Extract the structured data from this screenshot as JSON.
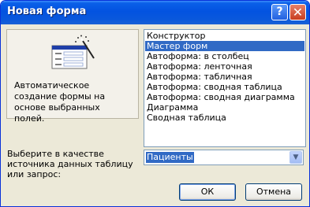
{
  "window": {
    "title": "Новая форма"
  },
  "titlebar": {
    "help_symbol": "?",
    "close_symbol": "✕"
  },
  "preview": {
    "icon": "form-wizard-icon",
    "description": "Автоматическое создание формы на основе выбранных полей."
  },
  "wizards": {
    "selected_index": 1,
    "items": [
      "Конструктор",
      "Мастер форм",
      "Автоформа: в столбец",
      "Автоформа: ленточная",
      "Автоформа: табличная",
      "Автоформа:  сводная таблица",
      "Автоформа:  сводная диаграмма",
      "Диаграмма",
      "Сводная таблица"
    ]
  },
  "source": {
    "label": "Выберите в качестве источника данных таблицу или запрос:",
    "value": "Пациенты",
    "dropdown_icon": "chevron-down-icon"
  },
  "buttons": {
    "ok": "ОК",
    "cancel": "Отмена"
  },
  "colors": {
    "titlebar": "#0353e0",
    "selection": "#316ac5",
    "dialog_bg": "#ece9d8"
  }
}
